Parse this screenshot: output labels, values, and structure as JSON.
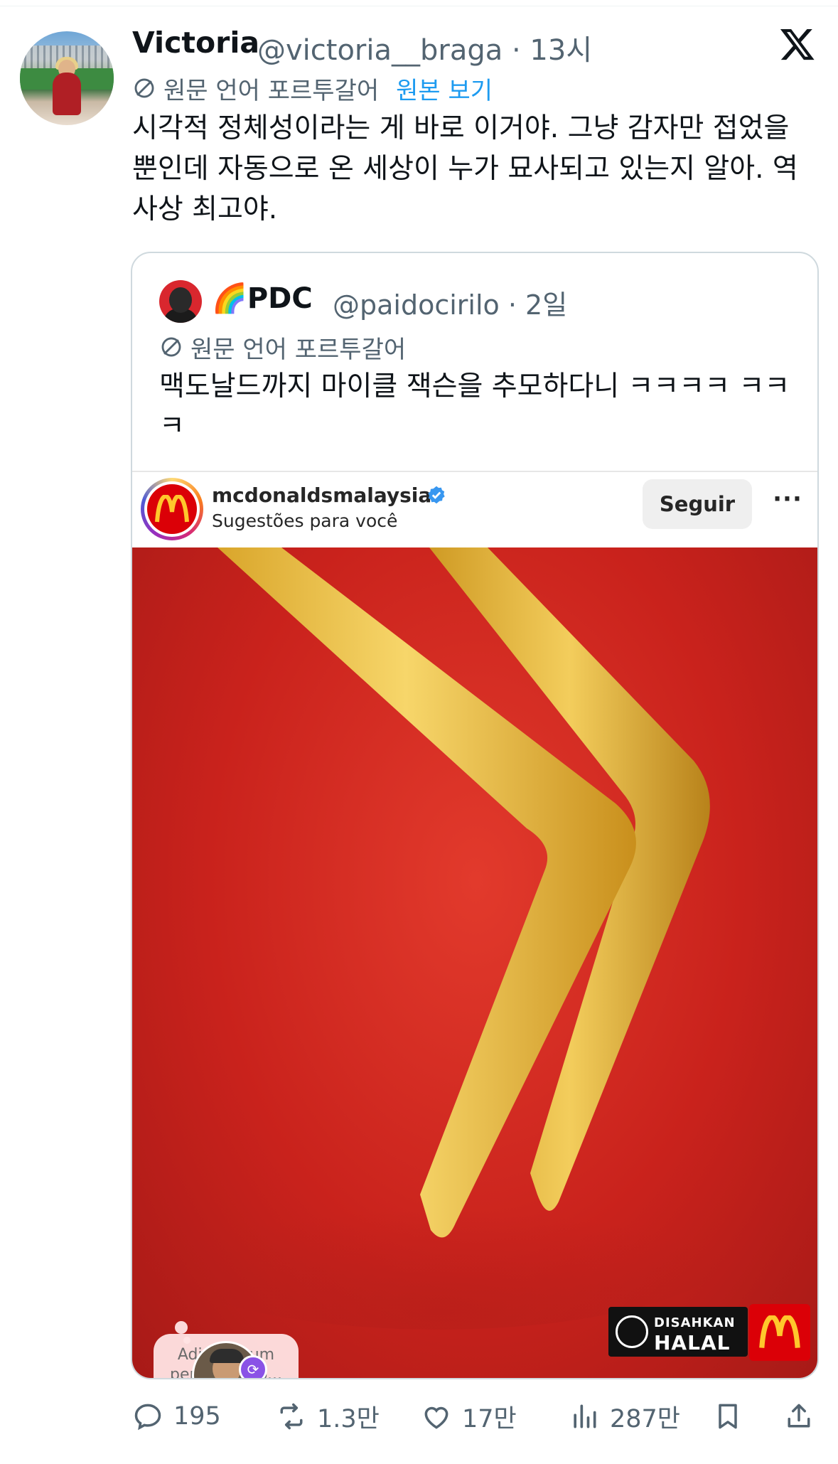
{
  "tweet": {
    "author_name": "Victoria",
    "author_handle": "@victoria__braga",
    "time": "13시",
    "translated_from": "원문 언어 포르투갈어",
    "view_original": "원본 보기",
    "text": "시각적 정체성이라는 게 바로 이거야. 그냥 감자만 접었을 뿐인데 자동으로 온 세상이 누가 묘사되고 있는지 알아. 역사상 최고야."
  },
  "quoted": {
    "author_emoji": "🌈",
    "author_name": "PDC",
    "author_handle": "@paidocirilo",
    "time": "2일",
    "translated_from": "원문 언어 포르투갈어",
    "text": "맥도날드까지 마이클 잭슨을 추모하다니 ㅋㅋㅋㅋ ㅋㅋㅋ"
  },
  "instagram": {
    "username": "mcdonaldsmalaysia",
    "subtitle": "Sugestões para você",
    "follow_label": "Seguir",
    "more_label": "···",
    "thought_placeholder": "Adicione um pensamento...",
    "halal_line1": "DISAHKAN",
    "halal_line2": "HALAL"
  },
  "actions": {
    "replies": "195",
    "reposts": "1.3만",
    "likes": "17만",
    "views": "287만"
  },
  "colors": {
    "accent": "#1d9bf0",
    "secondary_text": "#536471",
    "mcdonalds_red": "#db0007",
    "mcdonalds_yellow": "#ffc72c"
  }
}
